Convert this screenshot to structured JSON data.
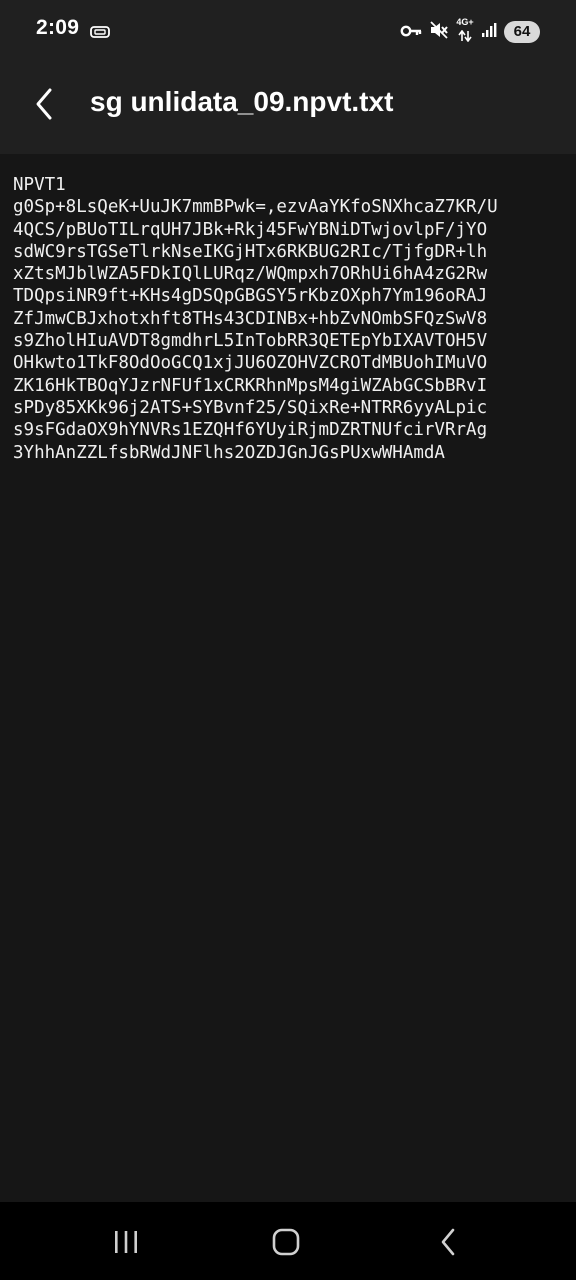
{
  "status_bar": {
    "time": "2:09",
    "network_type": "4G+",
    "battery_level": "64",
    "icons": [
      "notification-icon",
      "vpn-key-icon",
      "mute-icon",
      "data-arrows-icon",
      "signal-icon"
    ]
  },
  "app_bar": {
    "title": "sg unlidata_09.npvt.txt",
    "back_icon": "back-arrow-icon"
  },
  "file": {
    "lines": [
      "NPVT1",
      "g0Sp+8LsQeK+UuJK7mmBPwk=,ezvAaYKfoSNXhcaZ7KR/U",
      "4QCS/pBUoTILrqUH7JBk+Rkj45FwYBNiDTwjovlpF/jYO",
      "sdWC9rsTGSeTlrkNseIKGjHTx6RKBUG2RIc/TjfgDR+lh",
      "xZtsMJblWZA5FDkIQlLURqz/WQmpxh7ORhUi6hA4zG2Rw",
      "TDQpsiNR9ft+KHs4gDSQpGBGSY5rKbzOXph7Ym196oRAJ",
      "ZfJmwCBJxhotxhft8THs43CDINBx+hbZvNOmbSFQzSwV8",
      "s9ZholHIuAVDT8gmdhrL5InTobRR3QETEpYbIXAVTOH5V",
      "OHkwto1TkF8OdOoGCQ1xjJU6OZOHVZCROTdMBUohIMuVO",
      "ZK16HkTBOqYJzrNFUf1xCRKRhnMpsM4giWZAbGCSbBRvI",
      "sPDy85XKk96j2ATS+SYBvnf25/SQixRe+NTRR6yyALpic",
      "s9sFGdaOX9hYNVRs1EZQHf6YUyiRjmDZRTNUfcirVRrAg",
      "3YhhAnZZLfsbRWdJNFlhs2OZDJGnJGsPUxwWHAmdA"
    ]
  },
  "nav_bar": {
    "icons": [
      "recent-apps-icon",
      "home-icon",
      "back-icon"
    ]
  },
  "colors": {
    "bar_background": "#202020",
    "content_background": "#161616",
    "text": "#f0f0f0",
    "nav_background": "#000000"
  }
}
